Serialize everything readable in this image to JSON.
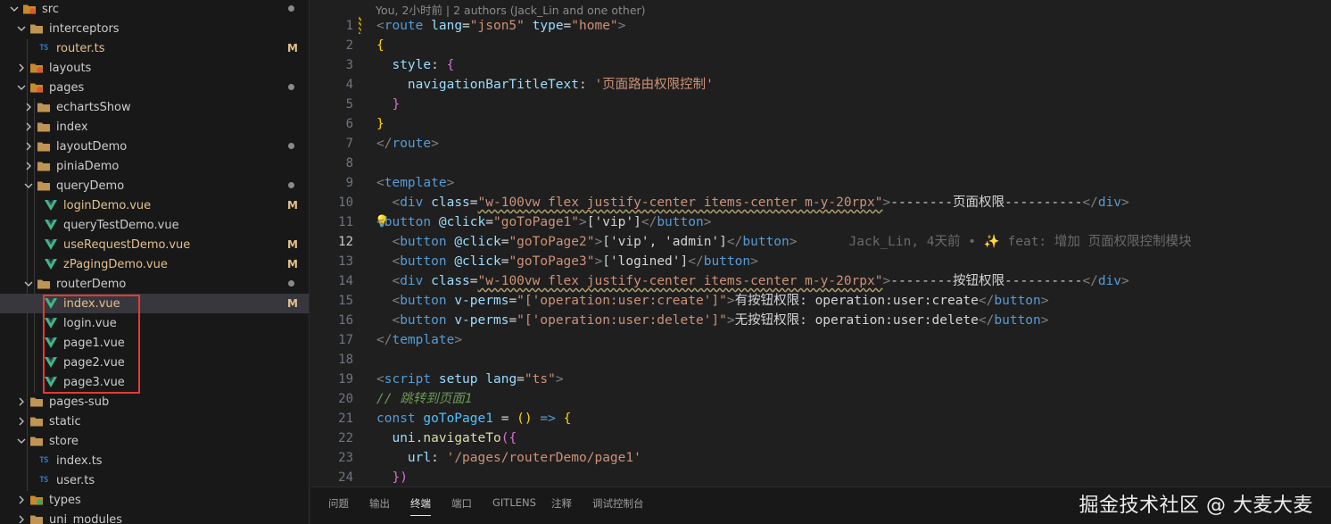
{
  "explorer": {
    "items": [
      {
        "label": "src",
        "kind": "folder-special",
        "status": "dot"
      },
      {
        "label": "interceptors",
        "kind": "folder",
        "status": ""
      },
      {
        "label": "router.ts",
        "kind": "ts",
        "status": "M"
      },
      {
        "label": "layouts",
        "kind": "folder-special",
        "status": ""
      },
      {
        "label": "pages",
        "kind": "folder-special",
        "status": "dot"
      },
      {
        "label": "echartsShow",
        "kind": "folder",
        "status": ""
      },
      {
        "label": "index",
        "kind": "folder",
        "status": ""
      },
      {
        "label": "layoutDemo",
        "kind": "folder",
        "status": "dot"
      },
      {
        "label": "piniaDemo",
        "kind": "folder",
        "status": ""
      },
      {
        "label": "queryDemo",
        "kind": "folder",
        "status": "dot"
      },
      {
        "label": "loginDemo.vue",
        "kind": "vue",
        "status": "M"
      },
      {
        "label": "queryTestDemo.vue",
        "kind": "vue",
        "status": ""
      },
      {
        "label": "useRequestDemo.vue",
        "kind": "vue",
        "status": "M"
      },
      {
        "label": "zPagingDemo.vue",
        "kind": "vue",
        "status": "M"
      },
      {
        "label": "routerDemo",
        "kind": "folder",
        "status": "dot"
      },
      {
        "label": "index.vue",
        "kind": "vue",
        "status": "M"
      },
      {
        "label": "login.vue",
        "kind": "vue",
        "status": ""
      },
      {
        "label": "page1.vue",
        "kind": "vue",
        "status": ""
      },
      {
        "label": "page2.vue",
        "kind": "vue",
        "status": ""
      },
      {
        "label": "page3.vue",
        "kind": "vue",
        "status": ""
      },
      {
        "label": "pages-sub",
        "kind": "folder",
        "status": ""
      },
      {
        "label": "static",
        "kind": "folder",
        "status": ""
      },
      {
        "label": "store",
        "kind": "folder",
        "status": ""
      },
      {
        "label": "index.ts",
        "kind": "ts",
        "status": ""
      },
      {
        "label": "user.ts",
        "kind": "ts",
        "status": ""
      },
      {
        "label": "types",
        "kind": "folder-special-green",
        "status": ""
      },
      {
        "label": "uni_modules",
        "kind": "folder",
        "status": ""
      }
    ]
  },
  "editor": {
    "blame_header": "You, 2小时前 | 2 authors (Jack_Lin and one other)",
    "line_numbers": [
      "1",
      "2",
      "3",
      "4",
      "5",
      "6",
      "7",
      "8",
      "9",
      "10",
      "11",
      "12",
      "13",
      "14",
      "15",
      "16",
      "17",
      "18",
      "19",
      "20",
      "21",
      "22",
      "23",
      "24"
    ],
    "active_line": "12",
    "inline_blame": "Jack_Lin, 4天前 • ✨ feat: 增加 页面权限控制模块",
    "text": {
      "l1_a": "route",
      "l1_b": "lang",
      "l1_c": "\"json5\"",
      "l1_d": "type",
      "l1_e": "\"home\"",
      "l2": "{",
      "l3_a": "style",
      "l3_b": "{",
      "l4_a": "navigationBarTitleText",
      "l4_b": "'页面路由权限控制'",
      "l5": "}",
      "l6": "}",
      "l7": "route",
      "l9": "template",
      "l10_a": "div",
      "l10_b": "class",
      "l10_c": "\"w-100vw flex justify-center items-center m-y-20rpx\"",
      "l10_d": "--------页面权限----------",
      "l10_e": "div",
      "l11_a": "button",
      "l11_b": "@click",
      "l11_c": "\"goToPage1\"",
      "l11_d": "['vip']",
      "l11_e": "button",
      "l12_a": "button",
      "l12_b": "@click",
      "l12_c": "\"goToPage2\"",
      "l12_d": "['vip', 'admin']",
      "l12_e": "button",
      "l13_a": "button",
      "l13_b": "@click",
      "l13_c": "\"goToPage3\"",
      "l13_d": "['logined']",
      "l13_e": "button",
      "l14_a": "div",
      "l14_b": "class",
      "l14_c": "\"w-100vw flex justify-center items-center m-y-20rpx\"",
      "l14_d": "--------按钮权限----------",
      "l14_e": "div",
      "l15_a": "button",
      "l15_b": "v-perms",
      "l15_c": "\"['operation:user:create']\"",
      "l15_d": "有按钮权限: operation:user:create",
      "l15_e": "button",
      "l16_a": "button",
      "l16_b": "v-perms",
      "l16_c": "\"['operation:user:delete']\"",
      "l16_d": "无按钮权限: operation:user:delete",
      "l16_e": "button",
      "l17": "template",
      "l19_a": "script",
      "l19_b": "setup",
      "l19_c": "lang",
      "l19_d": "\"ts\"",
      "l20": "// 跳转到页面1",
      "l21_a": "const",
      "l21_b": "goToPage1",
      "l21_c": "=",
      "l21_d": "()",
      "l21_e": "=>",
      "l21_f": "{",
      "l22_a": "uni",
      "l22_b": "navigateTo",
      "l22_c": "({",
      "l23_a": "url",
      "l23_b": "'/pages/routerDemo/page1'",
      "l24": "})"
    }
  },
  "panel": {
    "tabs": [
      "问题",
      "输出",
      "终端",
      "端口",
      "GITLENS",
      "注释",
      "调试控制台"
    ],
    "active_tab": "终端"
  },
  "watermark": "掘金技术社区 @ 大麦大麦",
  "colors": {
    "accent_highlight": "#e53935",
    "modified": "#e2c08d",
    "vue": "#41b883",
    "ts": "#3178c6"
  }
}
